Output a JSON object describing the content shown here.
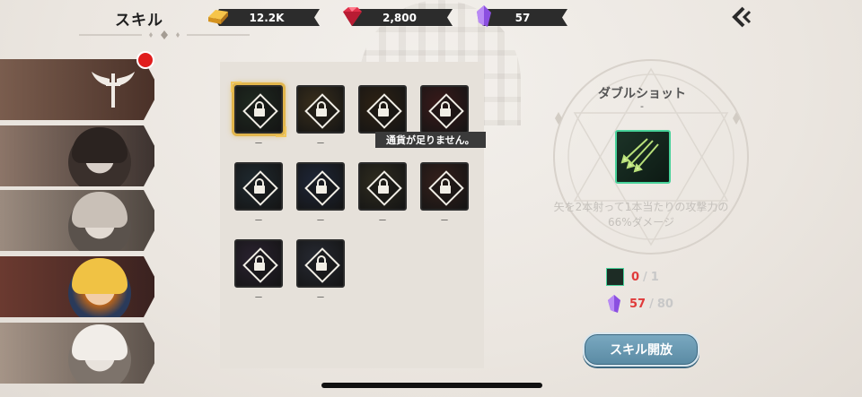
{
  "header": {
    "title": "スキル",
    "currencies": {
      "gold": {
        "icon": "gold-bar-icon",
        "value": "12.2K"
      },
      "ruby": {
        "icon": "ruby-gem-icon",
        "value": "2,800"
      },
      "crystal": {
        "icon": "purple-crystal-icon",
        "value": "57"
      }
    },
    "back_icon": "back-chevron-icon"
  },
  "characters": [
    {
      "name": "character-tab-1",
      "icon": "winged-emblem-icon",
      "has_notification": true
    },
    {
      "name": "character-tab-2",
      "icon": "portrait"
    },
    {
      "name": "character-tab-3",
      "icon": "portrait"
    },
    {
      "name": "character-tab-4",
      "icon": "portrait",
      "active": true
    },
    {
      "name": "character-tab-5",
      "icon": "portrait"
    }
  ],
  "skills": [
    {
      "label": "ㅡ",
      "selected": true,
      "color": "#1f2a20"
    },
    {
      "label": "ㅡ",
      "color": "#3a2f1c"
    },
    {
      "label": "ㅡ",
      "color": "#2e2214"
    },
    {
      "label": "ㅡ",
      "color": "#3a1a1a"
    },
    {
      "label": "ㅡ",
      "color": "#1f2a30"
    },
    {
      "label": "ㅡ",
      "color": "#1e2638"
    },
    {
      "label": "ㅡ",
      "color": "#2f2c1f"
    },
    {
      "label": "ㅡ",
      "color": "#35201b"
    },
    {
      "label": "ㅡ",
      "color": "#2a2230"
    },
    {
      "label": "ㅡ",
      "color": "#272a33"
    }
  ],
  "tooltip": "通貨が足りません。",
  "detail": {
    "name": "ダブルショット",
    "rank": "-",
    "description_line1": "矢を2本射って1本当たりの攻撃力の",
    "description_line2": "66%ダメージ",
    "requirement_item": {
      "have": "0",
      "need": "1"
    },
    "requirement_crystal": {
      "have": "57",
      "need": "80"
    },
    "unlock_button": "スキル開放"
  },
  "colors": {
    "accent_gold": "#e1b54c",
    "button_blue": "#6a9ab3",
    "warning_red": "#e03a3a",
    "skill_frame_green": "#48d29a"
  }
}
